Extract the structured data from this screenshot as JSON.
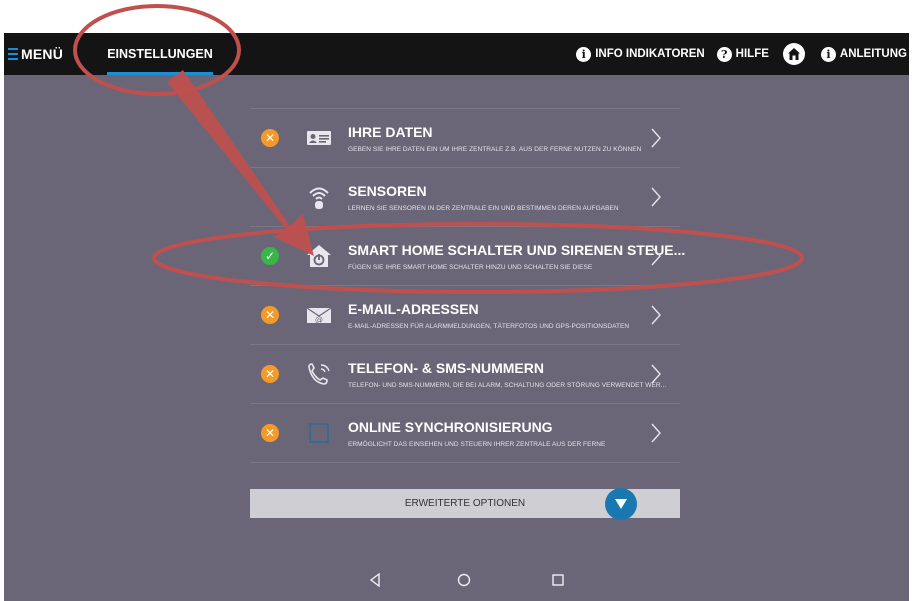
{
  "topbar": {
    "menu_label": "MENÜ",
    "active_tab": "EINSTELLUNGEN",
    "info_label": "INFO INDIKATOREN",
    "help_label": "HILFE",
    "guide_label": "ANLEITUNG"
  },
  "settings": [
    {
      "title": "IHRE DATEN",
      "subtitle": "GEBEN SIE IHRE DATEN EIN UM IHRE ZENTRALE Z.B. AUS DER FERNE NUTZEN ZU KÖNNEN",
      "status": "incomplete",
      "icon": "id-card-icon"
    },
    {
      "title": "SENSOREN",
      "subtitle": "LERNEN SIE SENSOREN IN DER ZENTRALE EIN UND BESTIMMEN DEREN AUFGABEN",
      "status": "none",
      "icon": "wifi-sensor-icon"
    },
    {
      "title": "SMART HOME SCHALTER UND SIRENEN STEUE...",
      "subtitle": "FÜGEN SIE IHRE SMART HOME SCHALTER HINZU UND SCHALTEN SIE DIESE",
      "status": "complete",
      "icon": "smart-home-power-icon"
    },
    {
      "title": "E-MAIL-ADRESSEN",
      "subtitle": "E-MAIL-ADRESSEN FÜR ALARMMELDUNGEN, TÄTERFOTOS UND GPS-POSITIONSDATEN",
      "status": "incomplete",
      "icon": "email-icon"
    },
    {
      "title": "TELEFON- & SMS-NUMMERN",
      "subtitle": "TELEFON- UND SMS-NUMMERN, DIE BEI ALARM, SCHALTUNG ODER STÖRUNG VERWENDET WER...",
      "status": "incomplete",
      "icon": "phone-icon"
    },
    {
      "title": "ONLINE SYNCHRONISIERUNG",
      "subtitle": "ERMÖGLICHT DAS EINSEHEN UND STEUERN IHRER ZENTRALE AUS DER FERNE",
      "status": "incomplete",
      "icon": "sync-icon"
    }
  ],
  "advanced": {
    "label": "ERWEITERTE OPTIONEN"
  },
  "colors": {
    "accent": "#1a8fd8",
    "background": "#6b6677",
    "incomplete": "#f39a29",
    "complete": "#39b54a",
    "annotation": "#c0504d"
  }
}
